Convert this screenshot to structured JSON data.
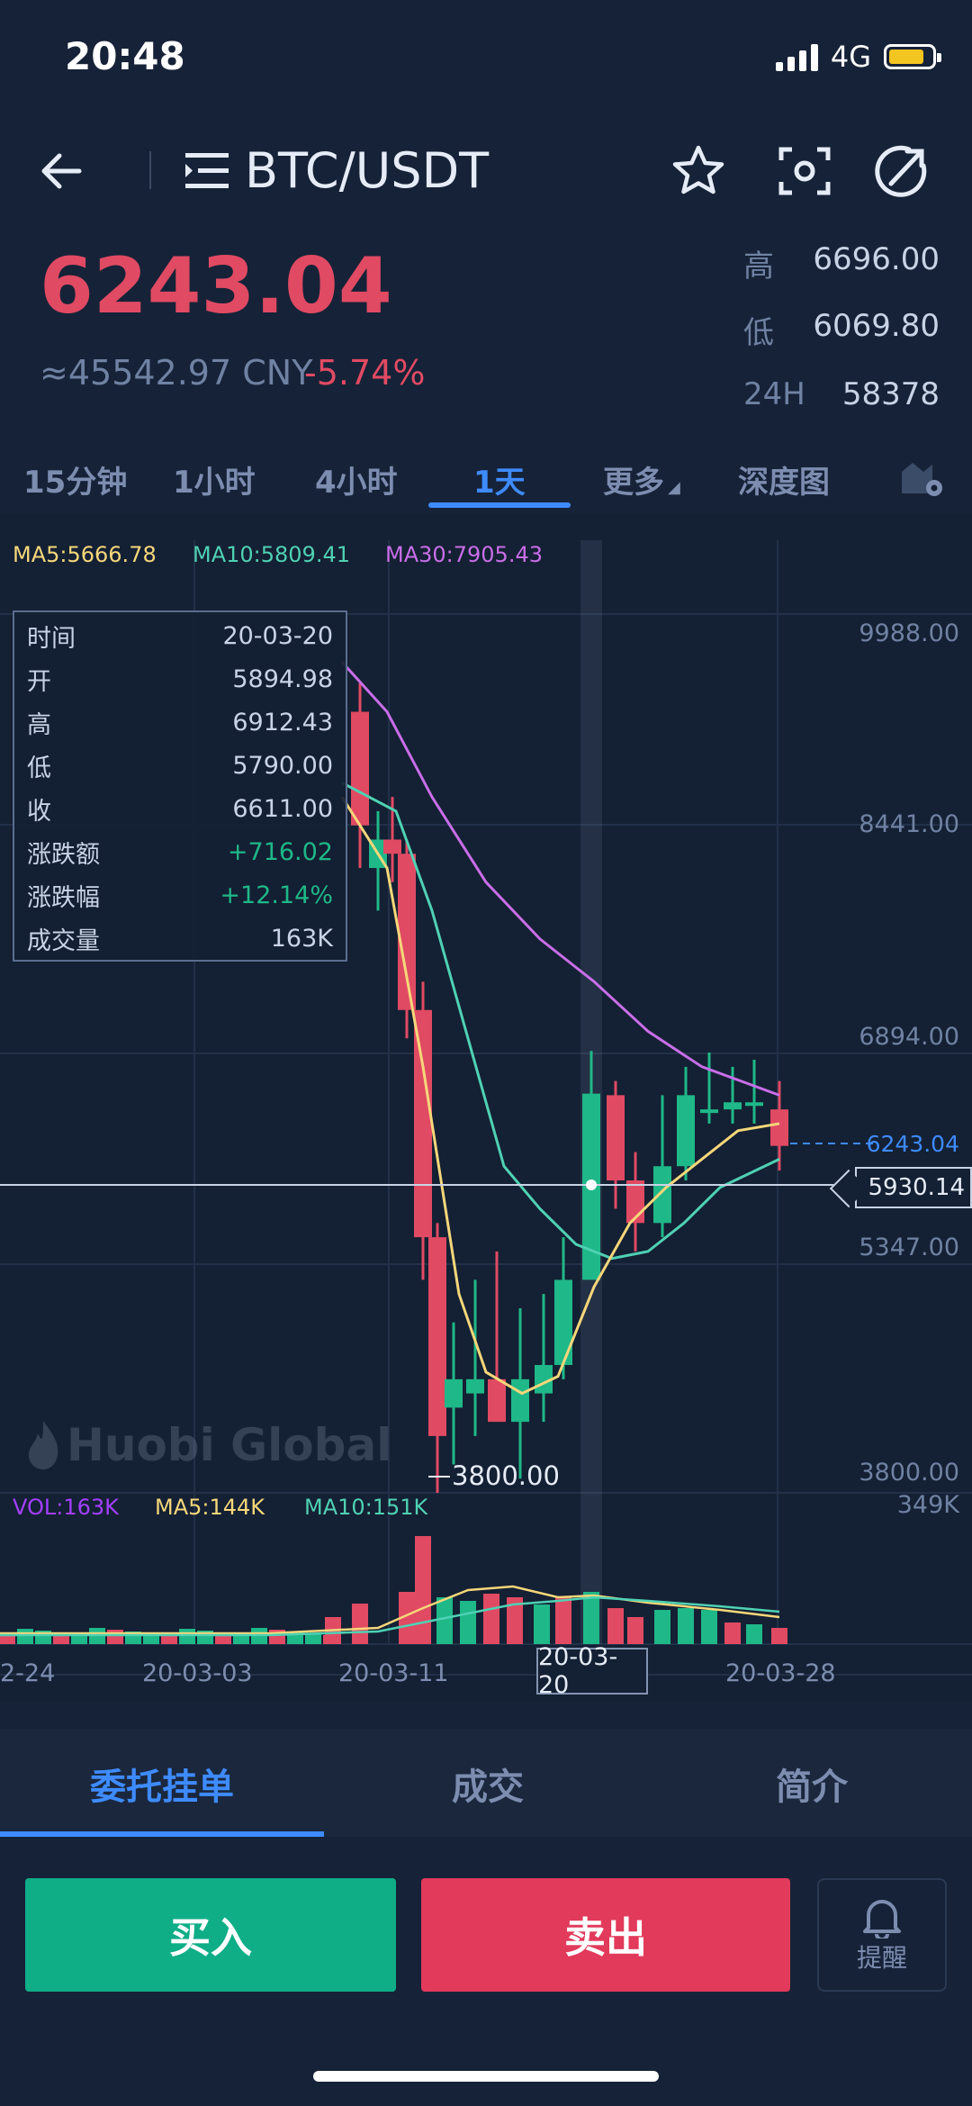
{
  "status": {
    "time": "20:48",
    "network": "4G"
  },
  "header": {
    "title": "BTC/USDT"
  },
  "price": {
    "last": "6243.04",
    "cny": "≈45542.97 CNY",
    "change": "-5.74%"
  },
  "stats": [
    {
      "label": "高",
      "value": "6696.00"
    },
    {
      "label": "低",
      "value": "6069.80"
    },
    {
      "label": "24H",
      "value": "58378"
    }
  ],
  "periods": [
    "15分钟",
    "1小时",
    "4小时",
    "1天",
    "更多",
    "深度图"
  ],
  "ma_legend": {
    "ma5": "MA5:5666.78",
    "ma10": "MA10:5809.41",
    "ma30": "MA30:7905.43"
  },
  "vol_legend": {
    "vol": "VOL:163K",
    "ma5": "MA5:144K",
    "ma10": "MA10:151K"
  },
  "tooltip": [
    {
      "label": "时间",
      "value": "20-03-20"
    },
    {
      "label": "开",
      "value": "5894.98"
    },
    {
      "label": "高",
      "value": "6912.43"
    },
    {
      "label": "低",
      "value": "5790.00"
    },
    {
      "label": "收",
      "value": "6611.00"
    },
    {
      "label": "涨跌额",
      "value": "+716.02"
    },
    {
      "label": "涨跌幅",
      "value": "+12.14%"
    },
    {
      "label": "成交量",
      "value": "163K"
    }
  ],
  "y_labels": [
    "9988.00",
    "8441.00",
    "6894.00",
    "5347.00",
    "3800.00"
  ],
  "last_price_label": "6243.04",
  "crosshair_value": "5930.14",
  "crosshair_date": "20-03-20",
  "min_label": "3800.00",
  "vol_max": "349K",
  "x_labels": [
    "2-24",
    "20-03-03",
    "20-03-11",
    "20-03-28"
  ],
  "watermark": "Huobi Global",
  "bottom_tabs": [
    "委托挂单",
    "成交",
    "简介"
  ],
  "buttons": {
    "buy": "买入",
    "sell": "卖出",
    "alert": "提醒"
  },
  "colors": {
    "up": "#1fb888",
    "down": "#e04a63",
    "accent": "#3e8bff",
    "ma5": "#f6d77a",
    "ma10": "#4fd1b4",
    "ma30": "#c86ee8",
    "vol": "#a340ff"
  }
}
